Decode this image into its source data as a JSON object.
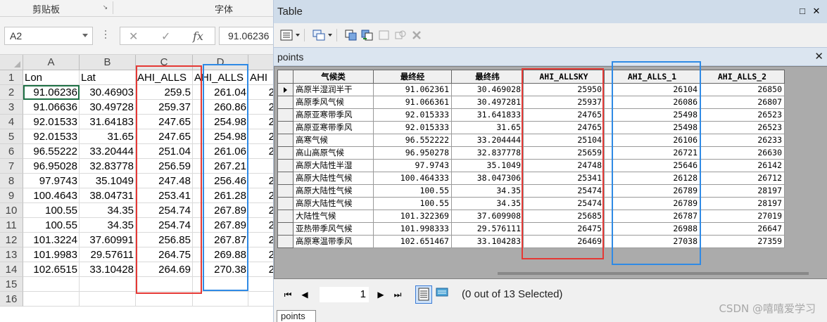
{
  "excel": {
    "ribbon": {
      "clipboard_label": "剪贴板",
      "font_label": "字体",
      "launcher_glyph": "↘"
    },
    "formula_bar": {
      "name_box": "A2",
      "cancel_glyph": "✕",
      "enter_glyph": "✓",
      "fx_glyph": "fx",
      "value": "91.06236"
    },
    "columns": [
      "A",
      "B",
      "C",
      "D",
      ""
    ],
    "row_numbers": [
      "1",
      "2",
      "3",
      "4",
      "5",
      "6",
      "7",
      "8",
      "9",
      "10",
      "11",
      "12",
      "13",
      "14",
      "15",
      "16"
    ],
    "header_row": [
      "Lon",
      "Lat",
      "AHI_ALLS",
      "AHI_ALLS",
      "AHI"
    ],
    "rows": [
      [
        "91.06236",
        "30.46903",
        "259.5",
        "261.04",
        "2"
      ],
      [
        "91.06636",
        "30.49728",
        "259.37",
        "260.86",
        "2"
      ],
      [
        "92.01533",
        "31.64183",
        "247.65",
        "254.98",
        "2"
      ],
      [
        "92.01533",
        "31.65",
        "247.65",
        "254.98",
        "2"
      ],
      [
        "96.55222",
        "33.20444",
        "251.04",
        "261.06",
        "2"
      ],
      [
        "96.95028",
        "32.83778",
        "256.59",
        "267.21",
        ""
      ],
      [
        "97.9743",
        "35.1049",
        "247.48",
        "256.46",
        "2"
      ],
      [
        "100.4643",
        "38.04731",
        "253.41",
        "261.28",
        "2"
      ],
      [
        "100.55",
        "34.35",
        "254.74",
        "267.89",
        "2"
      ],
      [
        "100.55",
        "34.35",
        "254.74",
        "267.89",
        "2"
      ],
      [
        "101.3224",
        "37.60991",
        "256.85",
        "267.87",
        "2"
      ],
      [
        "101.9983",
        "29.57611",
        "264.75",
        "269.88",
        "2"
      ],
      [
        "102.6515",
        "33.10428",
        "264.69",
        "270.38",
        "2"
      ]
    ]
  },
  "table_window": {
    "title": "Table",
    "restore_glyph": "□",
    "close_glyph": "✕",
    "tab_label": "points",
    "columns": [
      "气候类",
      "最终经",
      "最终纬",
      "AHI_ALLSKY",
      "AHI_ALLS_1",
      "AHI_ALLS_2"
    ],
    "rows": [
      [
        "高原半湿润半干",
        "91.062361",
        "30.469028",
        "25950",
        "26104",
        "26850"
      ],
      [
        "高原季风气候",
        "91.066361",
        "30.497281",
        "25937",
        "26086",
        "26807"
      ],
      [
        "高原亚寒带季风",
        "92.015333",
        "31.641833",
        "24765",
        "25498",
        "26523"
      ],
      [
        "高原亚寒带季风",
        "92.015333",
        "31.65",
        "24765",
        "25498",
        "26523"
      ],
      [
        "高寒气候",
        "96.552222",
        "33.204444",
        "25104",
        "26106",
        "26233"
      ],
      [
        "高山高原气候",
        "96.950278",
        "32.837778",
        "25659",
        "26721",
        "26630"
      ],
      [
        "高原大陆性半湿",
        "97.9743",
        "35.1049",
        "24748",
        "25646",
        "26142"
      ],
      [
        "高原大陆性气候",
        "100.464333",
        "38.047306",
        "25341",
        "26128",
        "26712"
      ],
      [
        "高原大陆性气候",
        "100.55",
        "34.35",
        "25474",
        "26789",
        "28197"
      ],
      [
        "高原大陆性气候",
        "100.55",
        "34.35",
        "25474",
        "26789",
        "28197"
      ],
      [
        "大陆性气候",
        "101.322369",
        "37.609908",
        "25685",
        "26787",
        "27019"
      ],
      [
        "亚热带季风气候",
        "101.998333",
        "29.576111",
        "26475",
        "26988",
        "26647"
      ],
      [
        "高原寒温带季风",
        "102.651467",
        "33.104283",
        "26469",
        "27038",
        "27359"
      ]
    ],
    "nav": {
      "first_glyph": "⏮",
      "prev_glyph": "◀",
      "record": "1",
      "next_glyph": "▶",
      "last_glyph": "⏭",
      "selection_status": "(0 out of 13 Selected)"
    },
    "bottom_tab": "points"
  },
  "watermark": "CSDN @嘻嘻爱学习",
  "colors": {
    "highlight_red": "#e53935",
    "highlight_blue": "#2f8ae5",
    "window_title_bg": "#cfdcea"
  }
}
